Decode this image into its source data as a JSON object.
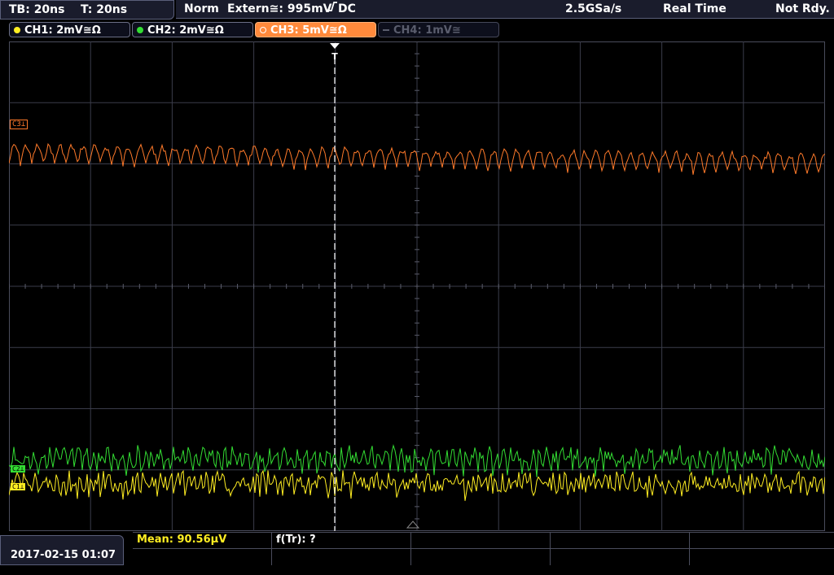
{
  "header": {
    "timebase": "TB: 20ns",
    "trigger_time": "T: 20ns",
    "mode": "Norm",
    "trigger_source": "Extern≅: 995mV",
    "trigger_slope": "DC",
    "sample_rate": "2.5GSa/s",
    "acq_mode": "Real Time",
    "status": "Not Rdy."
  },
  "channels": [
    {
      "label": "CH1: 2mV≅Ω",
      "color": "#ffee22",
      "state": "on"
    },
    {
      "label": "CH2: 2mV≅Ω",
      "color": "#33dd33",
      "state": "on"
    },
    {
      "label": "CH3: 5mV≅Ω",
      "color": "#ff8a3c",
      "state": "selected"
    },
    {
      "label": "CH4: 1mV≅",
      "color": "#5a5d6d",
      "state": "off"
    }
  ],
  "markers": {
    "c3": "C3",
    "c2": "C2",
    "c1": "C1",
    "trigger": "T"
  },
  "footer": {
    "datetime": "2017-02-15 01:07",
    "measurement_1": "Mean: 90.56µV",
    "measurement_2": "f(Tr): ?"
  },
  "traces": {
    "ch3_color": "#ff7a2a",
    "ch2_color": "#33dd33",
    "ch1_color": "#ffee22",
    "grid_color": "#3a3c4a",
    "trigger_line_color": "#ffffff"
  }
}
